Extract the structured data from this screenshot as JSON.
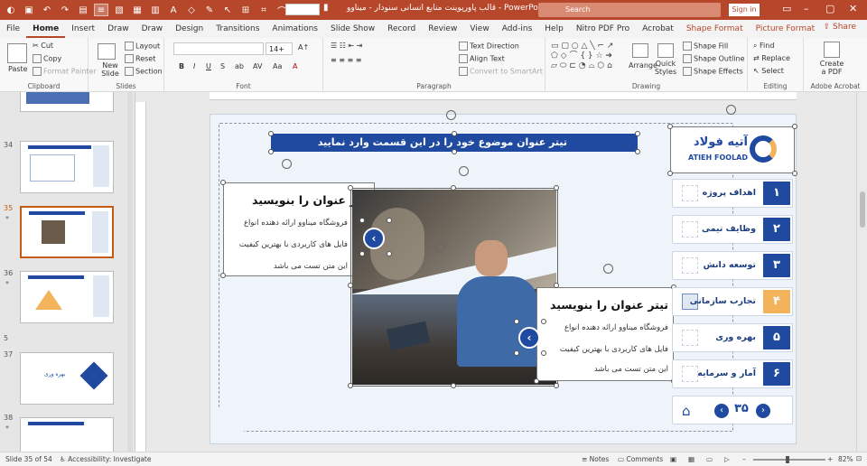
{
  "titlebar": {
    "title": "قالب پاورپوینت منابع انسانی سنودار - میناوو",
    "app": "PowerPoint",
    "search_placeholder": "Search",
    "signin": "Sign in"
  },
  "menu": {
    "tabs": [
      "File",
      "Home",
      "Insert",
      "Draw",
      "Draw",
      "Design",
      "Transitions",
      "Animations",
      "Slide Show",
      "Record",
      "Review",
      "View",
      "Add-ins",
      "Help",
      "Nitro PDF Pro",
      "Acrobat",
      "Shape Format",
      "Picture Format"
    ],
    "share": "Share"
  },
  "ribbon": {
    "paste": "Paste",
    "cut": "Cut",
    "copy": "Copy",
    "format_painter": "Format Painter",
    "clipboard": "Clipboard",
    "new_slide": "New Slide",
    "layout": "Layout",
    "reset": "Reset",
    "section": "Section",
    "slides": "Slides",
    "font_size": "14+",
    "font": "Font",
    "text_direction": "Text Direction",
    "align_text": "Align Text",
    "convert_smartart": "Convert to SmartArt",
    "paragraph": "Paragraph",
    "arrange": "Arrange",
    "quick_styles": "Quick Styles",
    "shape_fill": "Shape Fill",
    "shape_outline": "Shape Outline",
    "shape_effects": "Shape Effects",
    "drawing": "Drawing",
    "find": "Find",
    "replace": "Replace",
    "select": "Select",
    "editing": "Editing",
    "create_pdf": "Create a PDF",
    "adobe_acrobat": "Adobe Acrobat"
  },
  "thumbnails": [
    {
      "num": "34",
      "star": ""
    },
    {
      "num": "35",
      "star": "*"
    },
    {
      "num": "36",
      "star": "*"
    },
    {
      "num": "37",
      "star": ""
    },
    {
      "num": "38",
      "star": "*"
    }
  ],
  "thumb_section": "5",
  "thumb_37_text": "بهره وری",
  "slide": {
    "banner": "تیتر عنوان موضوع خود را در این قسمت وارد نمایید",
    "card1_title": "تیتر عنوان را بنویسید",
    "card1_body": [
      "فروشگاه میناوو ارائه دهنده انواع",
      "فایل های کاربردی با بهترین کیفیت",
      "این متن تست می باشد"
    ],
    "card2_title": "تیتر عنوان را بنویسید",
    "card2_body": [
      "فروشگاه میناوو ارائه دهنده انواع",
      "فایل های کاربردی با بهترین کیفیت",
      "این متن تست می باشد"
    ],
    "logo_fa": "آتیه فولاد",
    "logo_en": "ATIEH FOOLAD",
    "nav": [
      {
        "num": "۱",
        "label": "اهداف پروژه"
      },
      {
        "num": "۲",
        "label": "وظایف تیمی"
      },
      {
        "num": "۳",
        "label": "توسعه دانش"
      },
      {
        "num": "۴",
        "label": "تجارب سازمانی"
      },
      {
        "num": "۵",
        "label": "بهره وری"
      },
      {
        "num": "۶",
        "label": "آمار و سرمایه"
      }
    ],
    "page_number": "۳۵"
  },
  "status": {
    "slide_info": "Slide 35 of 54",
    "accessibility": "Accessibility: Investigate",
    "notes": "Notes",
    "comments": "Comments",
    "zoom": "82%"
  },
  "colors": {
    "brand": "#b7472a",
    "navy": "#1f4aa0",
    "accent": "#f2b35a"
  }
}
